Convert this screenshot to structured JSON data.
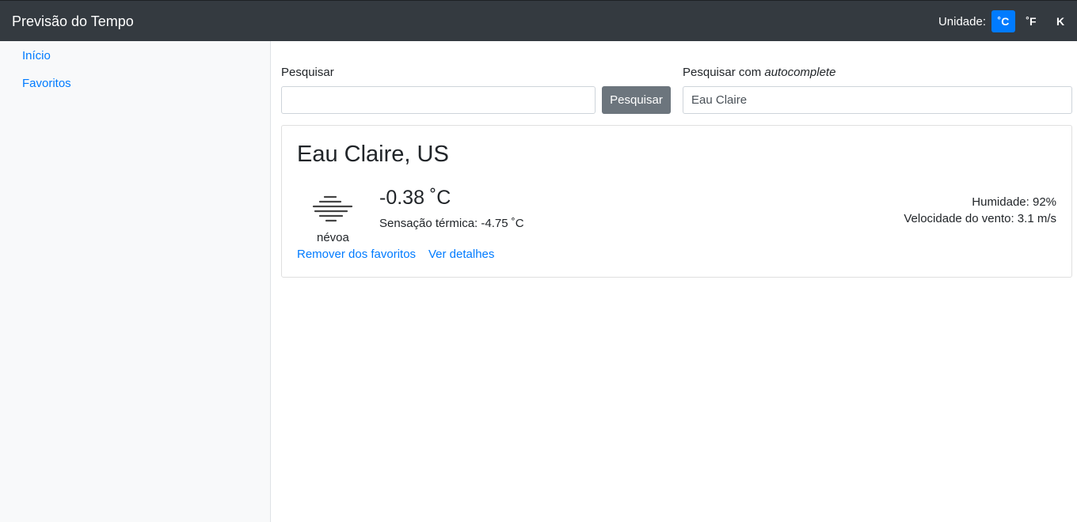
{
  "app": {
    "title": "Previsão do Tempo"
  },
  "units": {
    "label": "Unidade:",
    "options": [
      "˚C",
      "˚F",
      "K"
    ],
    "selected": "˚C"
  },
  "sidebar": {
    "items": [
      {
        "label": "Início"
      },
      {
        "label": "Favoritos"
      }
    ]
  },
  "search": {
    "label": "Pesquisar",
    "value": "",
    "button_label": "Pesquisar",
    "autocomplete_label_prefix": "Pesquisar com ",
    "autocomplete_label_em": "autocomplete",
    "autocomplete_value": "Eau Claire"
  },
  "card": {
    "city": "Eau Claire, US",
    "icon": "mist-icon",
    "description": "névoa",
    "temperature": "-0.38 ˚C",
    "feels_like": "Sensação térmica: -4.75 ˚C",
    "humidity": "Humidade: 92%",
    "wind": "Velocidade do vento: 3.1 m/s",
    "remove_link": "Remover dos favoritos",
    "details_link": "Ver detalhes"
  },
  "colors": {
    "navbar": "#343a40",
    "accent": "#007bff",
    "button_secondary": "#6c757d"
  }
}
